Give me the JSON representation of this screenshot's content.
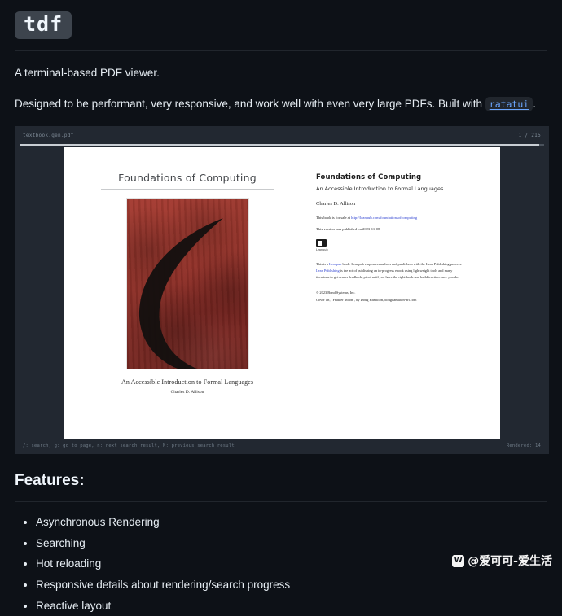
{
  "repo": {
    "title": "tdf",
    "tagline": "A terminal-based PDF viewer.",
    "description_prefix": "Designed to be performant, very responsive, and work well with even very large PDFs. Built with ",
    "description_link": "ratatui",
    "description_suffix": "."
  },
  "terminal": {
    "filename": "textbook.gen.pdf",
    "page_counter": "1 / 215",
    "progress_percent": 99,
    "status_hints": "/: search, g: go to page, n: next search result, N: previous search result",
    "status_rendered": "Rendered: 14"
  },
  "pdf": {
    "cover": {
      "title": "Foundations of Computing",
      "subtitle": "An Accessible Introduction to Formal Languages",
      "author": "Charles D. Allison"
    },
    "details": {
      "title": "Foundations of Computing",
      "subtitle": "An Accessible Introduction to Formal Languages",
      "author": "Charles D. Allison",
      "sale_prefix": "This book is for sale at ",
      "sale_link": "http://leanpub.com/foundationsofcomputing",
      "version": "This version was published on 2023-11-08",
      "logo_word": "Leanpub",
      "blurb_line1_a": "This is a ",
      "blurb_line1_link": "Leanpub",
      "blurb_line1_b": " book. Leanpub empowers authors and publishers with the Lean Publishing process.",
      "blurb_line2_link": "Lean Publishing",
      "blurb_line2": " is the act of publishing an in-progress ebook using lightweight tools and many",
      "blurb_line3": "iterations to get reader feedback, pivot until you have the right book and build traction once you do.",
      "copyright": "© 2023 Bond Systems, Inc.",
      "cover_credit": "Cover art, \"Feather Moon\", by Doug Hamilton, doughamilton-art.com"
    }
  },
  "features": {
    "heading": "Features:",
    "items": [
      "Asynchronous Rendering",
      "Searching",
      "Hot reloading",
      "Responsive details about rendering/search progress",
      "Reactive layout"
    ]
  },
  "watermark": {
    "mark": "W",
    "text": "@爱可可-爱生活"
  },
  "colors": {
    "background": "#0d1117",
    "link": "#6ba6ff",
    "terminal_bg": "#222831",
    "cover_red": "#923229"
  }
}
